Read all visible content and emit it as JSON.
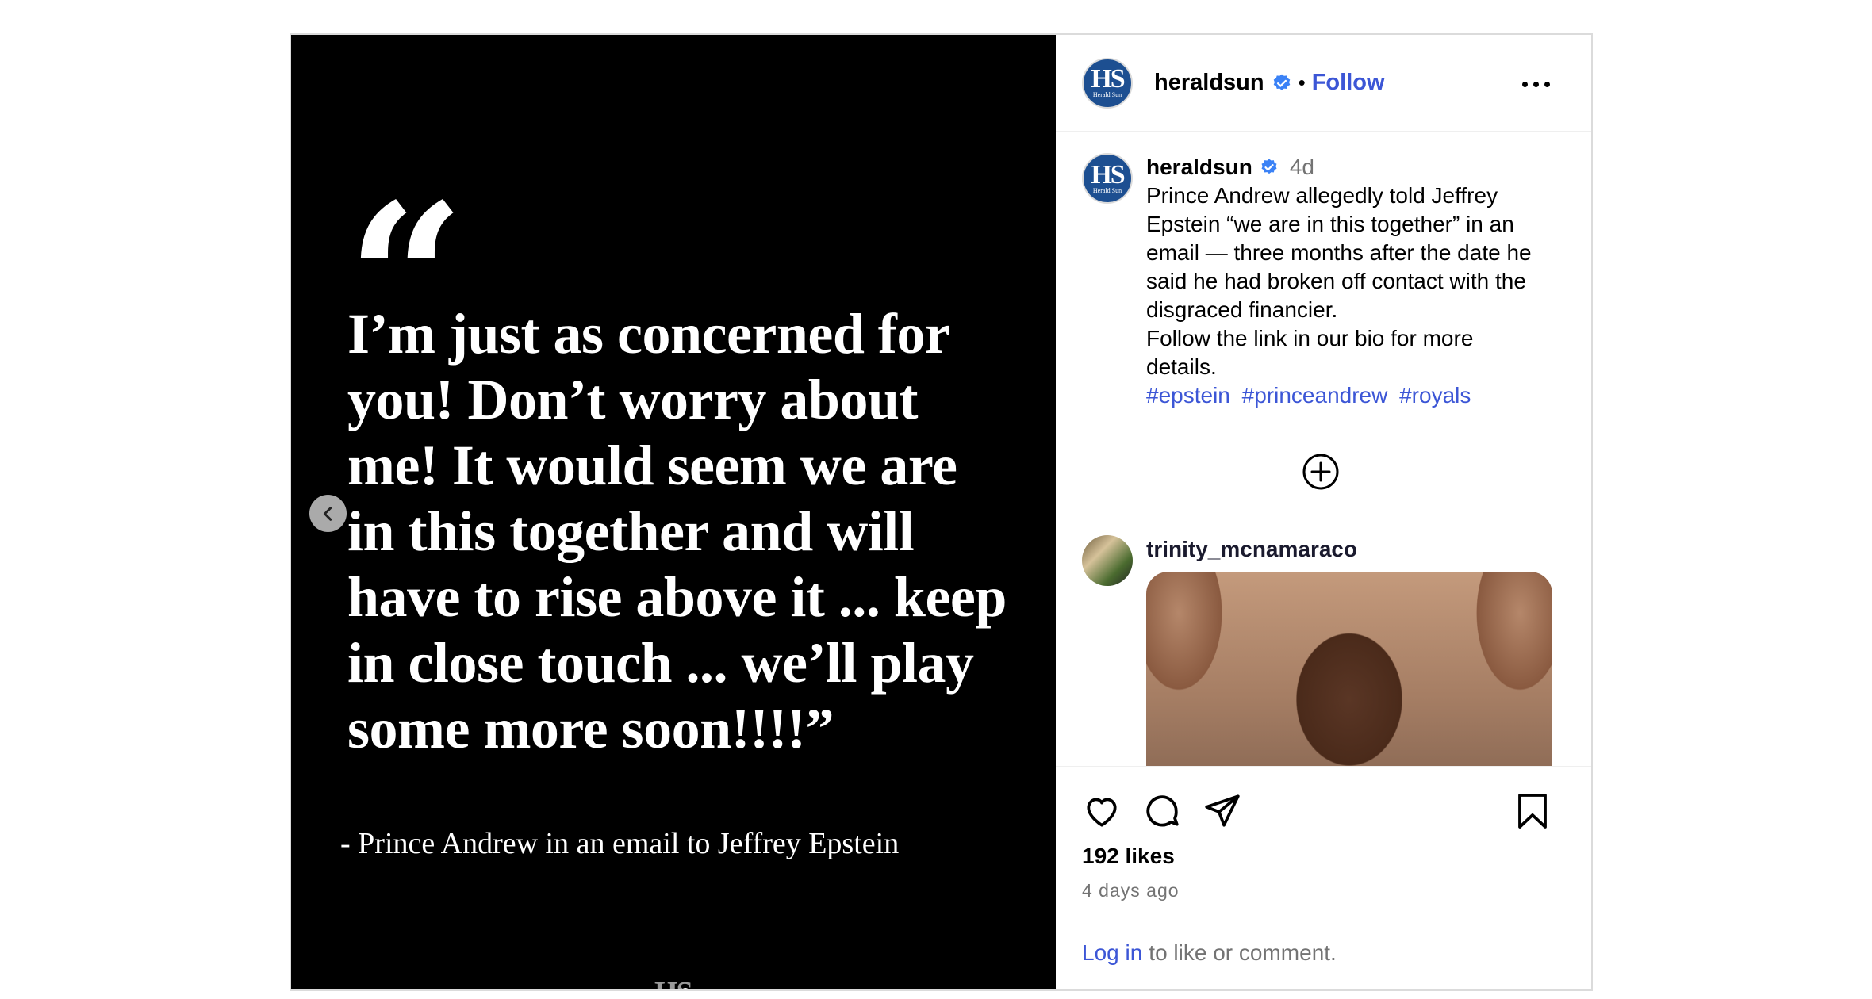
{
  "media": {
    "quote_mark": "“",
    "quote_text": "I’m just as concerned for you! Don’t worry about me! It would seem we are in this together and will have to rise above it ... keep in close touch ... we’ll play some more soon!!!!”",
    "attribution": "- Prince Andrew in an email to Jeffrey Epstein",
    "logo_text": "HS"
  },
  "header": {
    "avatar_text": "HS",
    "avatar_sub": "Herald Sun",
    "username": "heraldsun",
    "separator": "•",
    "follow_label": "Follow"
  },
  "caption": {
    "avatar_text": "HS",
    "avatar_sub": "Herald Sun",
    "username": "heraldsun",
    "time": "4d",
    "lines": [
      "Prince Andrew allegedly told Jeffrey",
      "Epstein “we are in this together” in an",
      "email — three months after the date he",
      "said he had broken off contact with the",
      "disgraced financier.",
      "Follow the link in our bio for more",
      "details."
    ],
    "hashtags": [
      "#epstein",
      "#princeandrew",
      "#royals"
    ]
  },
  "comment": {
    "username": "trinity_mcnamaraco"
  },
  "actions": {
    "likes": "192 likes",
    "time_ago": "4 days ago"
  },
  "login": {
    "link": "Log in",
    "text": "to like or comment."
  },
  "colors": {
    "accent": "#3c56d6",
    "verified": "#3b82f6",
    "muted": "#737373",
    "brand_blue": "#1d4f91"
  }
}
